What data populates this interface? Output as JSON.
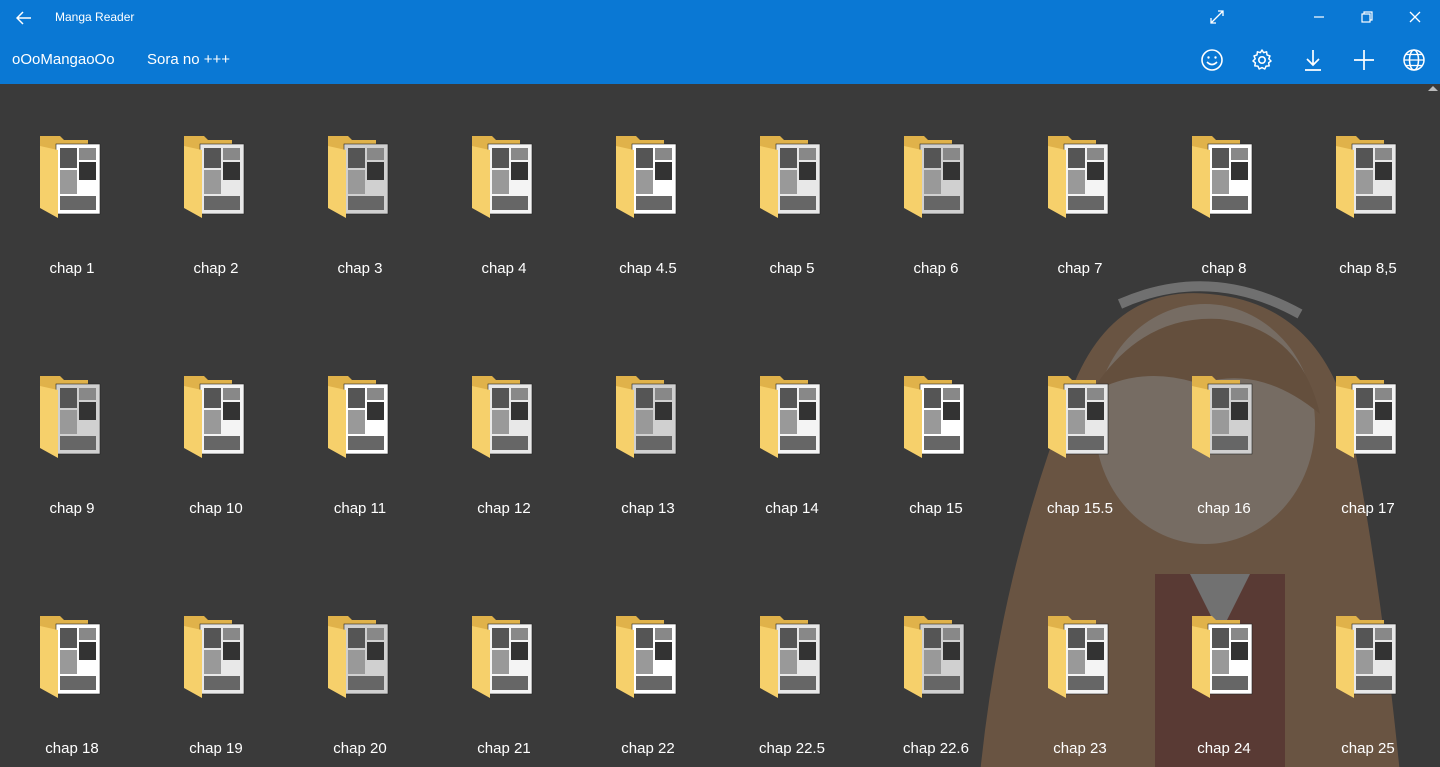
{
  "window": {
    "title": "Manga Reader",
    "back_icon": "back-arrow-icon",
    "expand_icon": "expand-icon",
    "minimize_icon": "minimize-icon",
    "restore_icon": "restore-icon",
    "close_icon": "close-icon"
  },
  "breadcrumb": {
    "items": [
      "oOoMangaoOo",
      "Sora no +++"
    ]
  },
  "toolbar": {
    "icons": [
      "smiley-icon",
      "gear-icon",
      "download-icon",
      "add-icon",
      "globe-icon"
    ]
  },
  "colors": {
    "accent": "#0a78d4",
    "background": "#3a3a3a",
    "folder": "#f6d06b",
    "folder_dark": "#e0b24a"
  },
  "folders": [
    {
      "label": "chap 1"
    },
    {
      "label": "chap 2"
    },
    {
      "label": "chap 3"
    },
    {
      "label": "chap 4"
    },
    {
      "label": "chap 4.5"
    },
    {
      "label": "chap 5"
    },
    {
      "label": "chap 6"
    },
    {
      "label": "chap 7"
    },
    {
      "label": "chap 8"
    },
    {
      "label": "chap 8,5"
    },
    {
      "label": "chap 9"
    },
    {
      "label": "chap 10"
    },
    {
      "label": "chap 11"
    },
    {
      "label": "chap 12"
    },
    {
      "label": "chap 13"
    },
    {
      "label": "chap 14"
    },
    {
      "label": "chap 15"
    },
    {
      "label": "chap 15.5"
    },
    {
      "label": "chap 16"
    },
    {
      "label": "chap 17"
    },
    {
      "label": "chap 18"
    },
    {
      "label": "chap 19"
    },
    {
      "label": "chap 20"
    },
    {
      "label": "chap 21"
    },
    {
      "label": "chap 22"
    },
    {
      "label": "chap 22.5"
    },
    {
      "label": "chap 22.6"
    },
    {
      "label": "chap 23"
    },
    {
      "label": "chap 24"
    },
    {
      "label": "chap 25"
    }
  ]
}
